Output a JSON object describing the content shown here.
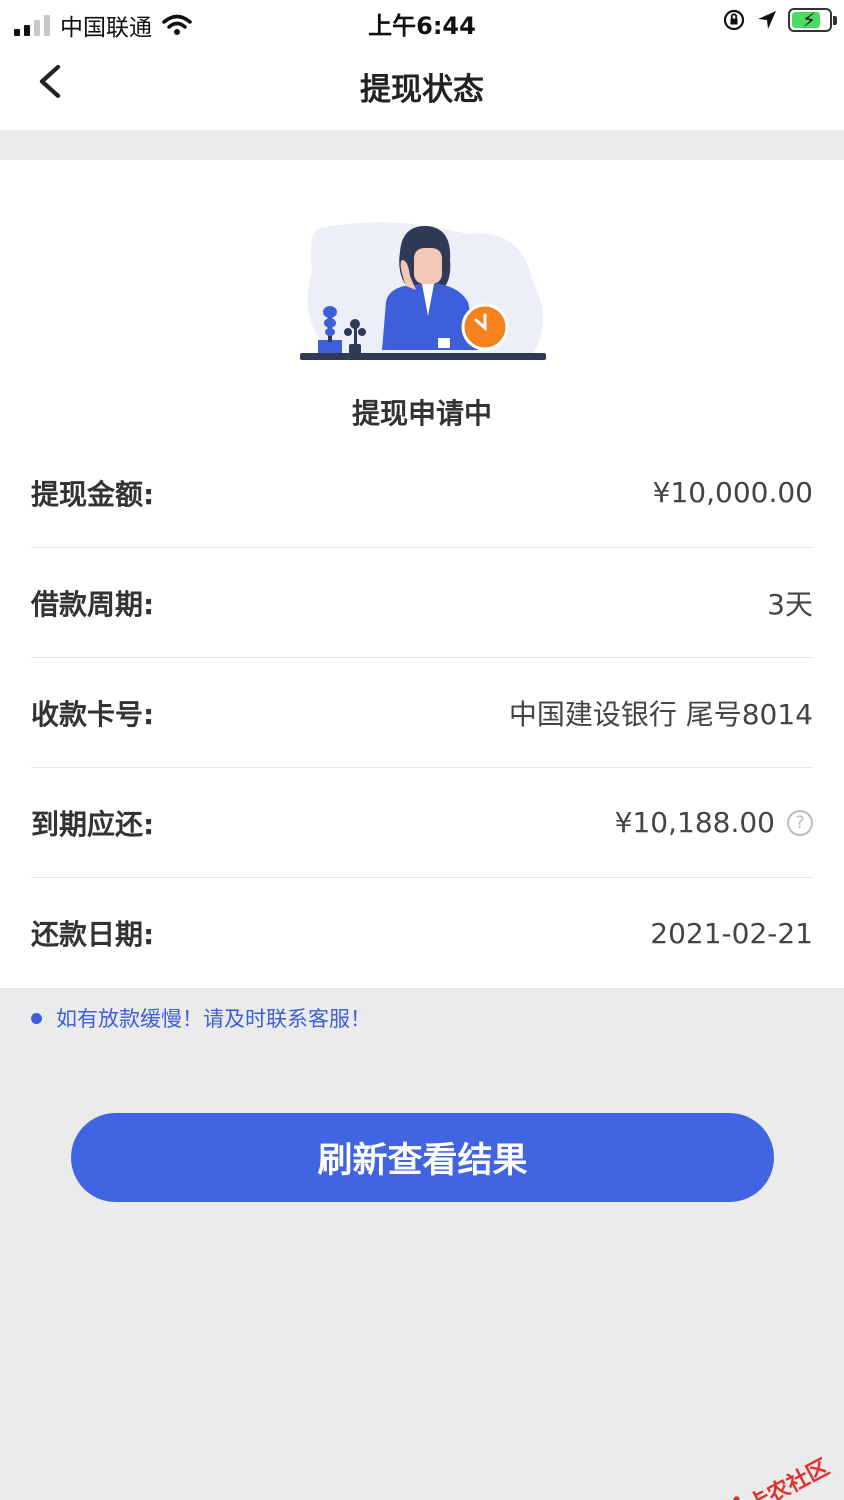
{
  "status_bar": {
    "carrier": "中国联通",
    "time": "上午6:44"
  },
  "nav": {
    "title": "提现状态"
  },
  "status": {
    "label": "提现申请中"
  },
  "details": [
    {
      "label": "提现金额:",
      "value": "¥10,000.00"
    },
    {
      "label": "借款周期:",
      "value": "3天"
    },
    {
      "label": "收款卡号:",
      "value": "中国建设银行 尾号8014"
    },
    {
      "label": "到期应还:",
      "value": "¥10,188.00"
    },
    {
      "label": "还款日期:",
      "value": "2021-02-21"
    }
  ],
  "notice": {
    "text": "如有放款缓慢！请及时联系客服！"
  },
  "actions": {
    "refresh_label": "刷新查看结果"
  },
  "watermark": {
    "text": "卡农社区"
  },
  "colors": {
    "accent": "#4164e0",
    "notice": "#3d5fd9",
    "watermark": "#e0322e",
    "clock_badge": "#f5811f"
  }
}
